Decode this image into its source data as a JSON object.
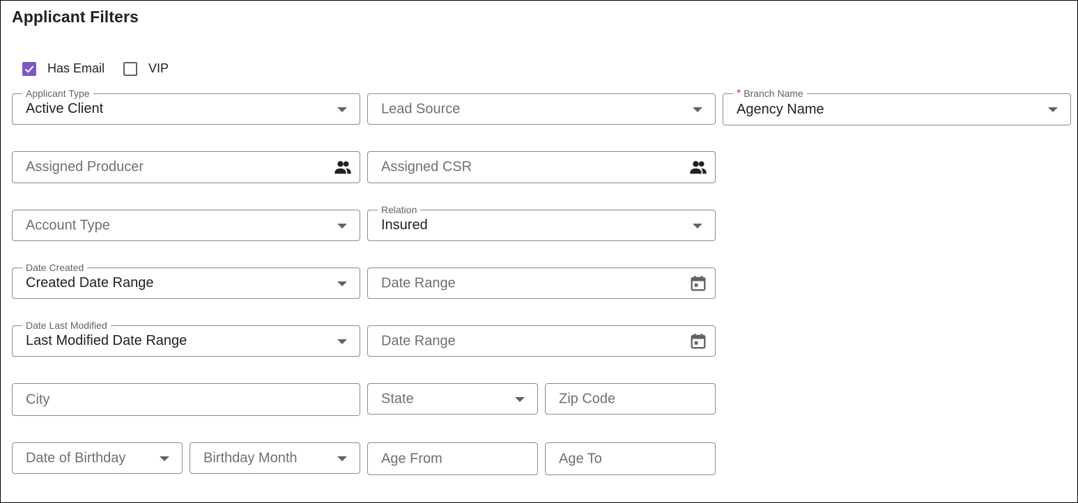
{
  "title": "Applicant Filters",
  "checkboxes": {
    "has_email": {
      "label": "Has Email",
      "checked": true
    },
    "vip": {
      "label": "VIP",
      "checked": false
    }
  },
  "fields": {
    "applicant_type": {
      "label": "Applicant Type",
      "value": "Active Client"
    },
    "lead_source": {
      "placeholder": "Lead Source"
    },
    "branch_name": {
      "label": "Branch Name",
      "required_mark": "*",
      "value": "Agency Name"
    },
    "assigned_producer": {
      "placeholder": "Assigned Producer",
      "icon": "people-icon"
    },
    "assigned_csr": {
      "placeholder": "Assigned CSR",
      "icon": "people-icon"
    },
    "account_type": {
      "placeholder": "Account Type"
    },
    "relation": {
      "label": "Relation",
      "value": "Insured"
    },
    "date_created": {
      "label": "Date Created",
      "value": "Created Date Range"
    },
    "date_created_range": {
      "placeholder": "Date Range",
      "icon": "calendar-icon"
    },
    "date_last_modified": {
      "label": "Date Last Modified",
      "value": "Last Modified Date Range"
    },
    "date_last_modified_range": {
      "placeholder": "Date Range",
      "icon": "calendar-icon"
    },
    "city": {
      "placeholder": "City"
    },
    "state": {
      "placeholder": "State"
    },
    "zip_code": {
      "placeholder": "Zip Code"
    },
    "date_of_birthday": {
      "placeholder": "Date of Birthday"
    },
    "birthday_month": {
      "placeholder": "Birthday Month"
    },
    "age_from": {
      "placeholder": "Age From"
    },
    "age_to": {
      "placeholder": "Age To"
    }
  },
  "colors": {
    "checkbox_accent": "#7e57c2",
    "required_mark": "#d32f2f",
    "border": "#8a8a8a"
  }
}
